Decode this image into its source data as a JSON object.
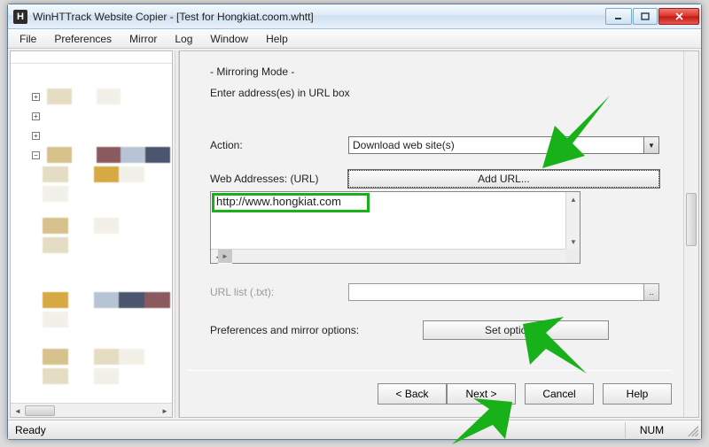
{
  "window": {
    "title": "WinHTTrack Website Copier - [Test for Hongkiat.coom.whtt]"
  },
  "menus": [
    "File",
    "Preferences",
    "Mirror",
    "Log",
    "Window",
    "Help"
  ],
  "form": {
    "mode": "- Mirroring Mode -",
    "sub": "Enter address(es) in URL box",
    "action_label": "Action:",
    "action_value": "Download web site(s)",
    "add_url_btn": "Add URL...",
    "web_label": "Web Addresses: (URL)",
    "url_value": "http://www.hongkiat.com",
    "urllist_label": "URL list (.txt):",
    "pref_label": "Preferences and mirror options:",
    "set_options_btn": "Set options..."
  },
  "wizard": {
    "back": "< Back",
    "next": "Next >",
    "cancel": "Cancel",
    "help": "Help"
  },
  "status": {
    "ready": "Ready",
    "num": "NUM"
  }
}
